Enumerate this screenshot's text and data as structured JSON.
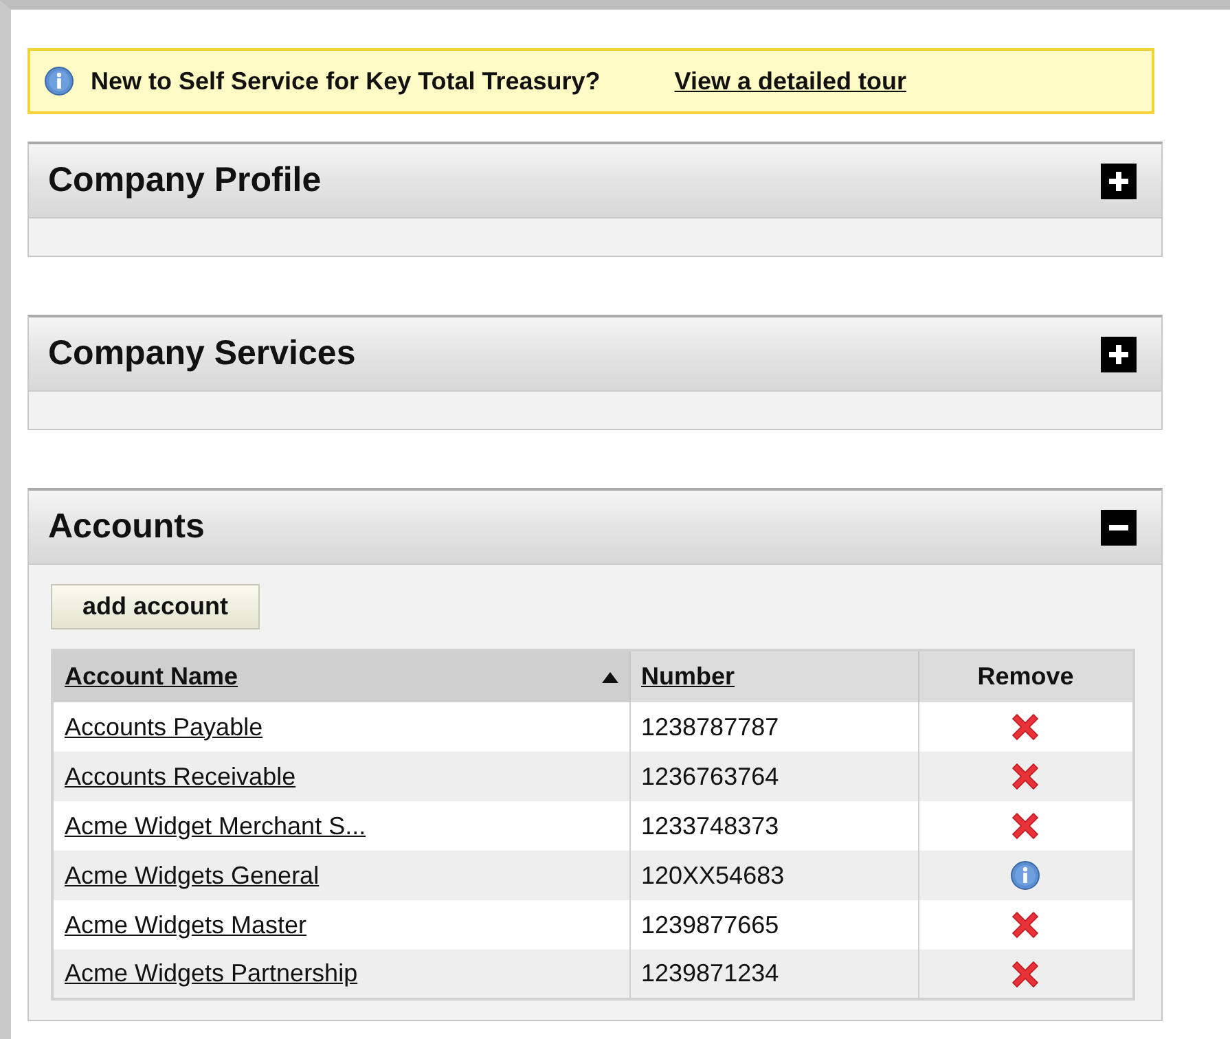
{
  "banner": {
    "text": "New to Self Service for Key Total Treasury?",
    "link": "View a detailed tour"
  },
  "panels": [
    {
      "title": "Company Profile",
      "expanded": false
    },
    {
      "title": "Company Services",
      "expanded": false
    },
    {
      "title": "Accounts",
      "expanded": true,
      "button": "add account",
      "table": {
        "columns": [
          {
            "label": "Account Name",
            "sortable": true,
            "sorted": true
          },
          {
            "label": "Number",
            "sortable": true,
            "sorted": false
          },
          {
            "label": "Remove",
            "sortable": false,
            "sorted": false
          }
        ],
        "rows": [
          {
            "name": "Accounts Payable",
            "number": "1238787787",
            "kind": "remove"
          },
          {
            "name": "Accounts Receivable",
            "number": "1236763764",
            "kind": "remove"
          },
          {
            "name": "Acme Widget Merchant S...",
            "number": "1233748373",
            "kind": "remove"
          },
          {
            "name": "Acme Widgets General",
            "number": "120XX54683",
            "kind": "info"
          },
          {
            "name": "Acme Widgets Master",
            "number": "1239877665",
            "kind": "remove"
          },
          {
            "name": "Acme Widgets Partnership",
            "number": "1239871234",
            "kind": "remove"
          }
        ]
      }
    }
  ]
}
